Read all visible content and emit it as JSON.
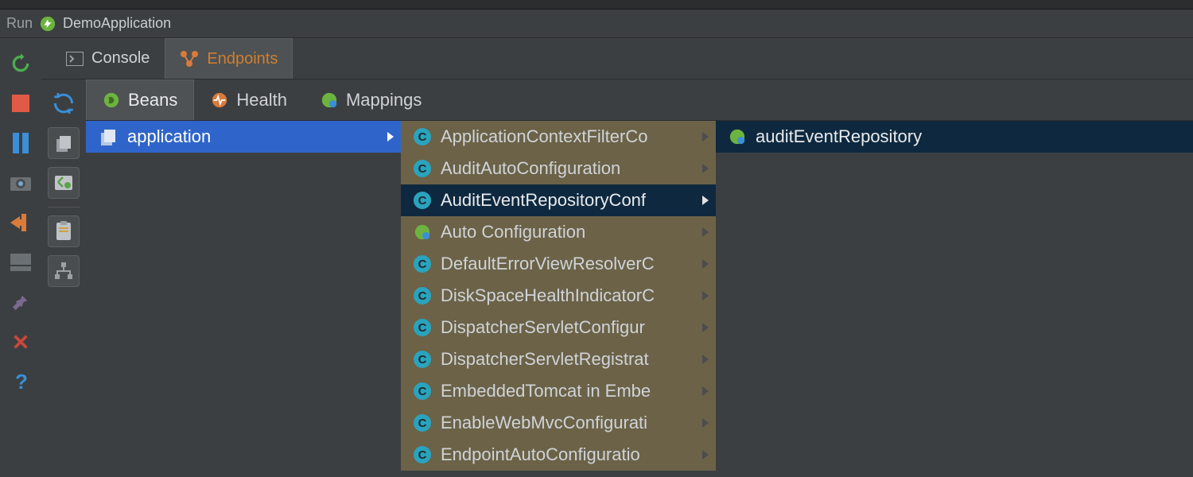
{
  "header": {
    "run_label": "Run",
    "app_title": "DemoApplication"
  },
  "tabs1": {
    "console": "Console",
    "endpoints": "Endpoints",
    "active": "endpoints"
  },
  "tabs2": {
    "beans": "Beans",
    "health": "Health",
    "mappings": "Mappings",
    "active": "beans"
  },
  "col1": {
    "items": [
      {
        "label": "application"
      }
    ],
    "selected": 0
  },
  "col2": {
    "items": [
      {
        "label": "ApplicationContextFilterCo",
        "icon": "class"
      },
      {
        "label": "AuditAutoConfiguration",
        "icon": "class"
      },
      {
        "label": "AuditEventRepositoryConf",
        "icon": "class"
      },
      {
        "label": "Auto Configuration",
        "icon": "spring"
      },
      {
        "label": "DefaultErrorViewResolverC",
        "icon": "class"
      },
      {
        "label": "DiskSpaceHealthIndicatorC",
        "icon": "class"
      },
      {
        "label": "DispatcherServletConfigur",
        "icon": "class"
      },
      {
        "label": "DispatcherServletRegistrat",
        "icon": "class"
      },
      {
        "label": "EmbeddedTomcat in Embe",
        "icon": "class"
      },
      {
        "label": "EnableWebMvcConfigurati",
        "icon": "class"
      },
      {
        "label": "EndpointAutoConfiguratio",
        "icon": "class"
      }
    ],
    "selected": 2
  },
  "col3": {
    "items": [
      {
        "label": "auditEventRepository",
        "icon": "spring"
      }
    ],
    "selected": 0
  }
}
